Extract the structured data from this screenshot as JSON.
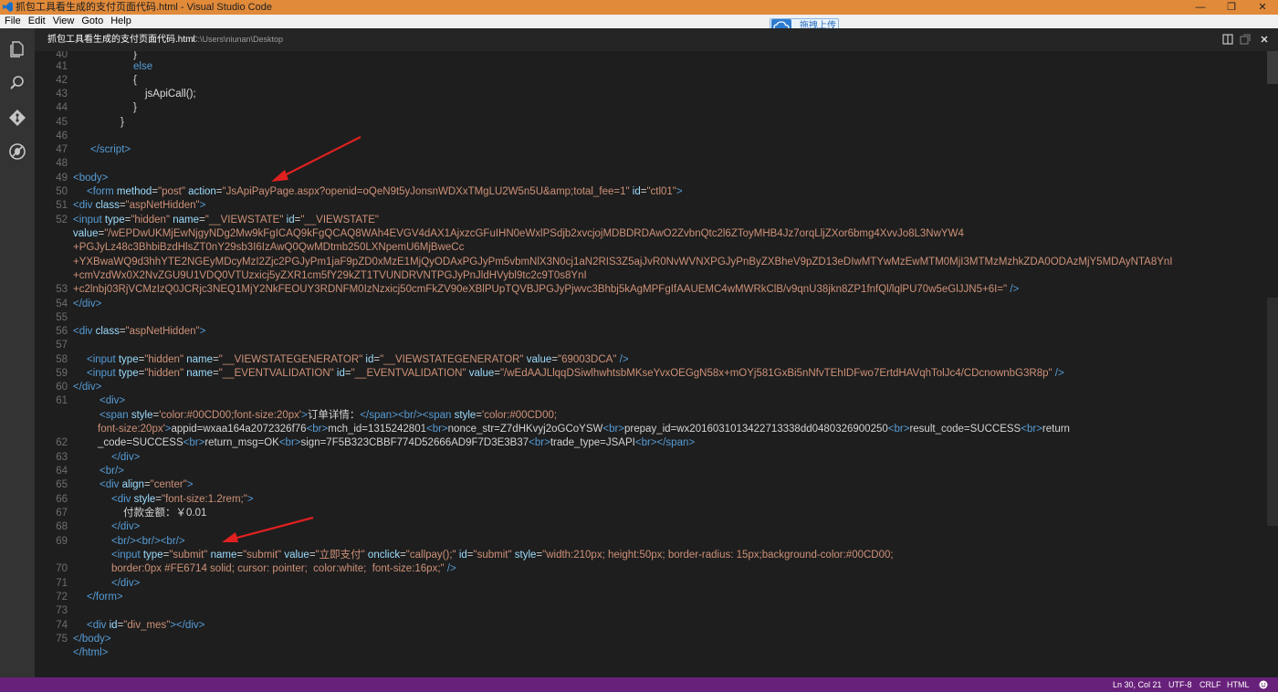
{
  "window": {
    "title": "抓包工具看生成的支付页面代码.html - Visual Studio Code",
    "min_symbol": "—",
    "restore_symbol": "❐",
    "close_symbol": "✕"
  },
  "menu": [
    "File",
    "Edit",
    "View",
    "Goto",
    "Help"
  ],
  "upload_widget": {
    "label": "拖拽上传"
  },
  "activity": [
    "explorer-icon",
    "search-icon",
    "git-icon",
    "debug-icon"
  ],
  "tab": {
    "filename": "抓包工具看生成的支付页面代码.html",
    "path": "C:\\Users\\niunan\\Desktop"
  },
  "line_numbers": [
    "40",
    "41",
    "42",
    "43",
    "44",
    "45",
    "46",
    "47",
    "48",
    "49",
    "50",
    "51",
    "52",
    "",
    "",
    "",
    "",
    "53",
    "54",
    "55",
    "56",
    "57",
    "58",
    "59",
    "60",
    "61",
    "",
    "",
    "62",
    "63",
    "64",
    "65",
    "66",
    "67",
    "68",
    "69",
    "",
    "70",
    "71",
    "72",
    "73",
    "74",
    "75"
  ],
  "status": {
    "position": "Ln 30, Col 21",
    "encoding": "UTF-8",
    "eol": "CRLF",
    "language": "HTML"
  },
  "colors": {
    "titlebar": "#e08a3a",
    "statusbar": "#68217a",
    "tag": "#569cd6",
    "attr": "#9cdcfe",
    "string": "#ce9178",
    "arrow": "#e02020"
  }
}
